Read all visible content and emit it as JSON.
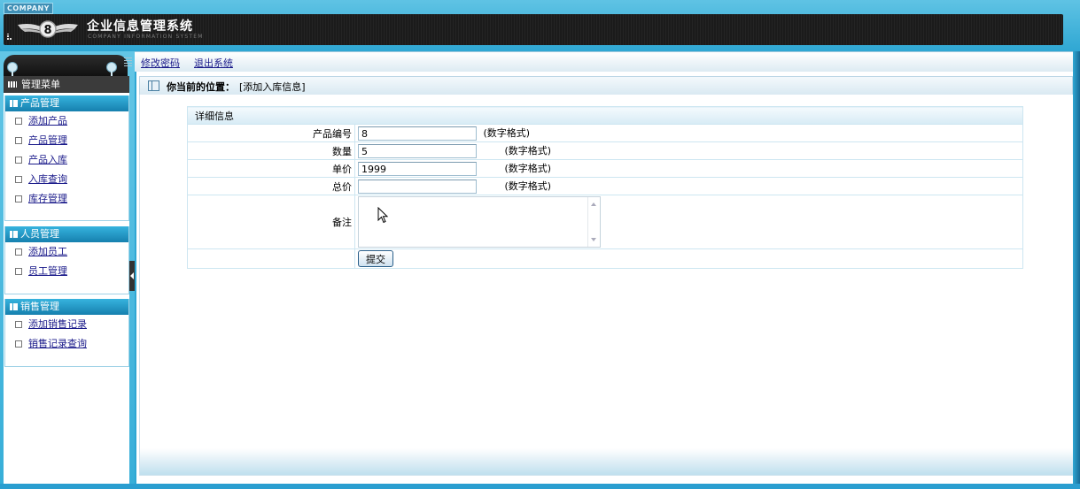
{
  "header": {
    "company_tag": "COMPANY",
    "app_title": "企业信息管理系统",
    "app_subtitle": "COMPANY INFORMATION SYSTEM",
    "logo_glyph": "8"
  },
  "toolbar": {
    "change_password": "修改密码",
    "logout": "退出系统"
  },
  "sidebar": {
    "menu_title": "管理菜单",
    "groups": [
      {
        "title": "产品管理",
        "items": [
          "添加产品",
          "产品管理",
          "产品入库",
          "入库查询",
          "库存管理"
        ]
      },
      {
        "title": "人员管理",
        "items": [
          "添加员工",
          "员工管理"
        ]
      },
      {
        "title": "销售管理",
        "items": [
          "添加销售记录",
          "销售记录查询"
        ]
      }
    ]
  },
  "breadcrumb": {
    "label": "你当前的位置：",
    "value": "[添加入库信息]"
  },
  "form": {
    "section_title": "详细信息",
    "product_id": {
      "label": "产品编号",
      "value": "8",
      "hint": "(数字格式)"
    },
    "quantity": {
      "label": "数量",
      "value": "5",
      "hint": "(数字格式)"
    },
    "unit_price": {
      "label": "单价",
      "value": "1999",
      "hint": "(数字格式)"
    },
    "total_price": {
      "label": "总价",
      "value": "",
      "hint": "(数字格式)"
    },
    "remark": {
      "label": "备注",
      "value": ""
    },
    "submit_label": "提交"
  },
  "colors": {
    "frame_blue": "#2fa7d3",
    "group_header": "#1680ae",
    "link": "#1a1a8a"
  }
}
